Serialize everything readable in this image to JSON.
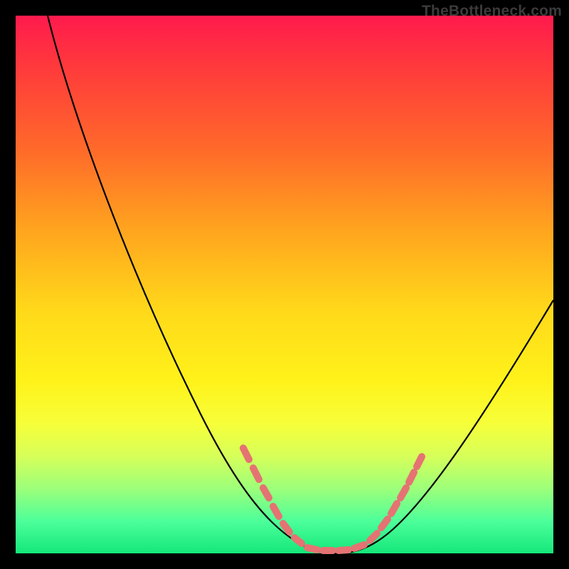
{
  "watermark": "TheBottleneck.com",
  "chart_data": {
    "type": "line",
    "title": "",
    "xlabel": "",
    "ylabel": "",
    "xlim": [
      0,
      100
    ],
    "ylim": [
      0,
      100
    ],
    "grid": false,
    "legend": false,
    "x": [
      6,
      10,
      15,
      20,
      25,
      30,
      35,
      40,
      45,
      47,
      50,
      53,
      55,
      58,
      60,
      63,
      65,
      70,
      75,
      80,
      85,
      90,
      95,
      100
    ],
    "series": [
      {
        "name": "bottleneck-curve",
        "values": [
          100,
          90,
          78,
          66,
          55,
          44,
          34,
          25,
          16,
          11,
          6,
          3,
          1,
          0,
          0,
          0,
          1,
          4,
          10,
          18,
          27,
          36,
          45,
          54
        ]
      }
    ],
    "highlights": {
      "name": "optimal-range-markers",
      "color": "#e57373",
      "points_x": [
        42,
        44,
        46,
        48,
        50,
        52,
        54,
        56,
        58,
        60,
        62,
        64,
        66,
        68,
        70,
        72
      ],
      "points_y": [
        21,
        17,
        13,
        9,
        6,
        3.5,
        1.5,
        0.5,
        0,
        0,
        0.5,
        1.5,
        3,
        5.5,
        9,
        13
      ]
    },
    "background_gradient": {
      "top": "#ff1a4d",
      "bottom": "#14e77a"
    }
  }
}
